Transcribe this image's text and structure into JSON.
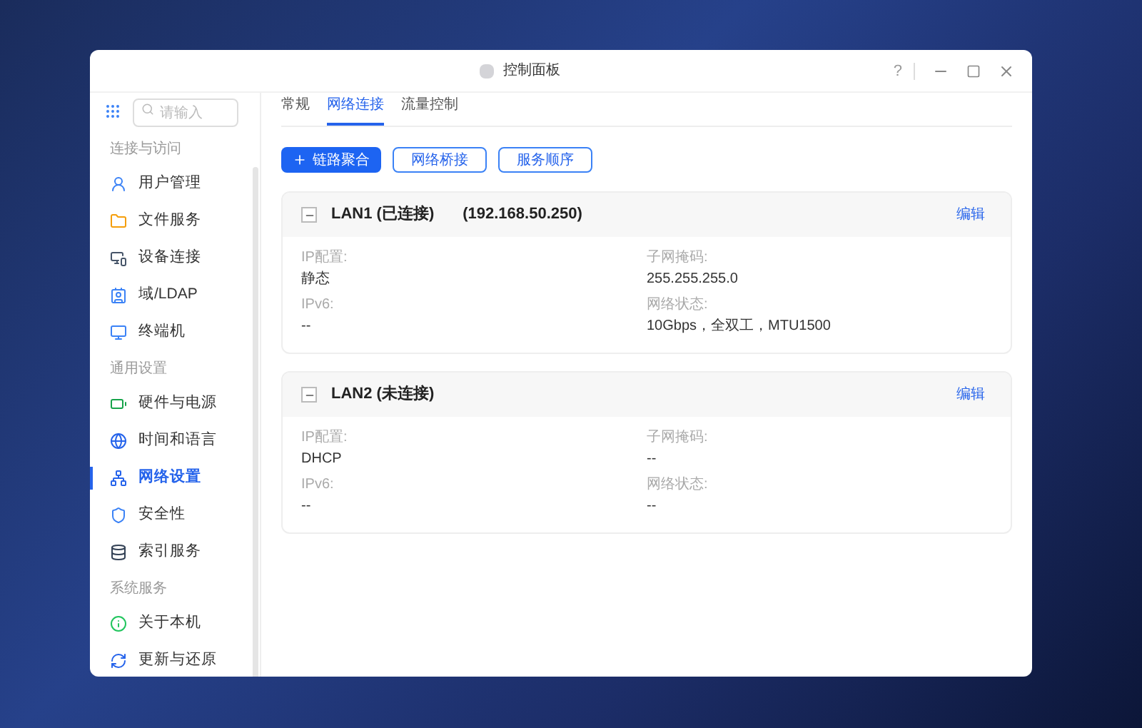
{
  "window": {
    "title": "控制面板",
    "help": "?"
  },
  "sidebar": {
    "search": {
      "placeholder": "请输入"
    },
    "sections": [
      {
        "title": "连接与访问",
        "items": [
          {
            "label": "用户管理",
            "selected": false
          },
          {
            "label": "文件服务",
            "selected": false
          },
          {
            "label": "设备连接",
            "selected": false
          },
          {
            "label": "域/LDAP",
            "selected": false
          },
          {
            "label": "终端机",
            "selected": false
          }
        ]
      },
      {
        "title": "通用设置",
        "items": [
          {
            "label": "硬件与电源",
            "selected": false
          },
          {
            "label": "时间和语言",
            "selected": false
          },
          {
            "label": "网络设置",
            "selected": true
          },
          {
            "label": "安全性",
            "selected": false
          },
          {
            "label": "索引服务",
            "selected": false
          }
        ]
      },
      {
        "title": "系统服务",
        "items": [
          {
            "label": "关于本机",
            "selected": false
          },
          {
            "label": "更新与还原",
            "selected": false
          }
        ]
      }
    ]
  },
  "tabs": [
    {
      "label": "常规",
      "selected": false
    },
    {
      "label": "网络连接",
      "selected": true
    },
    {
      "label": "流量控制",
      "selected": false
    }
  ],
  "buttons": [
    {
      "label": "链路聚合",
      "kind": "primary"
    },
    {
      "label": "网络桥接",
      "kind": "outline"
    },
    {
      "label": "服务顺序",
      "kind": "outline"
    }
  ],
  "interfaces": [
    {
      "name": "LAN1 (已连接)",
      "address": "(192.168.50.250)",
      "edit": "编辑",
      "expanded": true,
      "fields": [
        {
          "label": "IP配置:",
          "value": "静态"
        },
        {
          "label": "子网掩码:",
          "value": "255.255.255.0"
        },
        {
          "label": "IPv6:",
          "value": "--"
        },
        {
          "label": "网络状态:",
          "value": "10Gbps，全双工，MTU1500"
        }
      ]
    },
    {
      "name": "LAN2 (未连接)",
      "edit": "编辑",
      "expanded": true,
      "fields": [
        {
          "label": "IP配置:",
          "value": "DHCP"
        },
        {
          "label": "子网掩码:",
          "value": "--"
        },
        {
          "label": "IPv6:",
          "value": "--"
        },
        {
          "label": "网络状态:",
          "value": "--"
        }
      ]
    }
  ]
}
